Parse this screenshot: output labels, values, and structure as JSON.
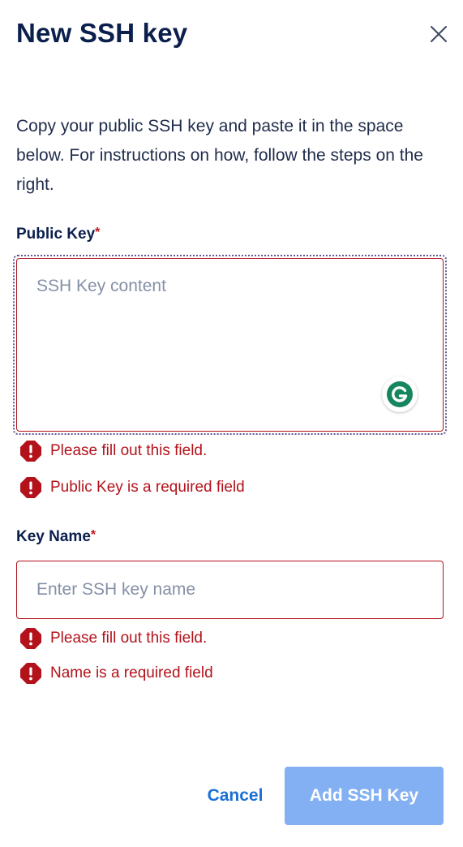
{
  "dialog": {
    "title": "New SSH key",
    "close_icon": "close-icon",
    "intro": "Copy your public SSH key and paste it in the space below. For instructions on how, follow the steps on the right."
  },
  "public_key": {
    "label": "Public Key",
    "required_marker": "*",
    "placeholder": "SSH Key content",
    "value": "",
    "assist_icon": "grammarly-icon",
    "errors": [
      "Please fill out this field.",
      "Public Key is a required field"
    ]
  },
  "key_name": {
    "label": "Key Name",
    "required_marker": "*",
    "placeholder": "Enter SSH key name",
    "value": "",
    "errors": [
      "Please fill out this field.",
      "Name is a required field"
    ]
  },
  "actions": {
    "cancel_label": "Cancel",
    "submit_label": "Add SSH Key",
    "submit_disabled": true
  },
  "colors": {
    "title_text": "#0b1f4d",
    "error": "#b3121b",
    "link_blue": "#1b6fd6",
    "submit_disabled_bg": "#83b0f3",
    "grammarly_green": "#15865e"
  }
}
